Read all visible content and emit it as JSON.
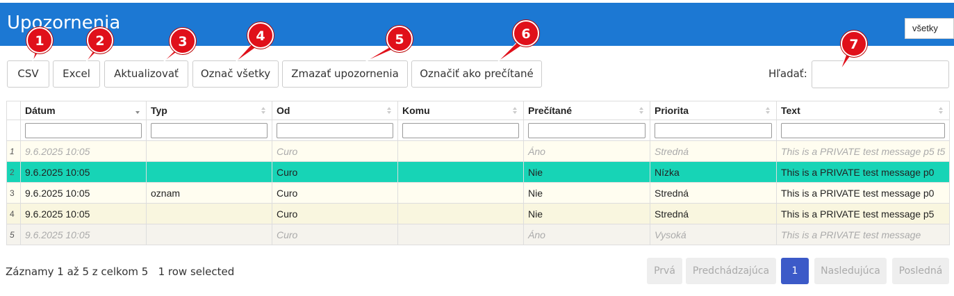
{
  "header": {
    "title": "Upozornenia",
    "filter_value": "všetky"
  },
  "toolbar": {
    "csv": "CSV",
    "excel": "Excel",
    "refresh": "Aktualizovať",
    "select_all": "Označ všetky",
    "delete": "Zmazať upozornenia",
    "mark_read": "Označiť ako prečítané",
    "search_label": "Hľadať:"
  },
  "markers": [
    "1",
    "2",
    "3",
    "4",
    "5",
    "6",
    "7"
  ],
  "table": {
    "columns": [
      "Dátum",
      "Typ",
      "Od",
      "Komu",
      "Prečítané",
      "Priorita",
      "Text"
    ],
    "rows": [
      {
        "n": "1",
        "date": "9.6.2025 10:05",
        "type": "",
        "from": "Curo",
        "to": "",
        "read": "Áno",
        "priority": "Stredná",
        "text": "This is a PRIVATE test message p5 t5"
      },
      {
        "n": "2",
        "date": "9.6.2025 10:05",
        "type": "",
        "from": "Curo",
        "to": "",
        "read": "Nie",
        "priority": "Nízka",
        "text": "This is a PRIVATE test message p0"
      },
      {
        "n": "3",
        "date": "9.6.2025 10:05",
        "type": "oznam",
        "from": "Curo",
        "to": "",
        "read": "Nie",
        "priority": "Stredná",
        "text": "This is a PRIVATE test message p0"
      },
      {
        "n": "4",
        "date": "9.6.2025 10:05",
        "type": "",
        "from": "Curo",
        "to": "",
        "read": "Nie",
        "priority": "Stredná",
        "text": "This is a PRIVATE test message p5"
      },
      {
        "n": "5",
        "date": "9.6.2025 10:05",
        "type": "",
        "from": "Curo",
        "to": "",
        "read": "Áno",
        "priority": "Vysoká",
        "text": "This is a PRIVATE test message"
      }
    ]
  },
  "footer": {
    "info": "Záznamy 1 až 5 z celkom 5",
    "selected": "1 row selected",
    "pagination": {
      "first": "Prvá",
      "prev": "Predchádzajúca",
      "page": "1",
      "next": "Nasledujúca",
      "last": "Posledná"
    }
  },
  "colors": {
    "header": "#1c78d3",
    "marker": "#e0101a",
    "selected_row": "#17d4b6",
    "active_page": "#3c5ac8"
  }
}
